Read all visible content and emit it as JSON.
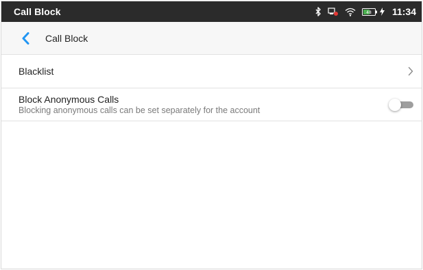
{
  "status_bar": {
    "title": "Call Block",
    "time": "11:34",
    "icons": [
      "bluetooth-icon",
      "network-disconnected-icon",
      "wifi-icon",
      "battery-icon",
      "charging-icon"
    ],
    "battery_label": "48"
  },
  "app_bar": {
    "back_icon": "chevron-left-icon",
    "title": "Call Block",
    "accent_color": "#2196f3"
  },
  "settings": {
    "blacklist": {
      "label": "Blacklist",
      "icon": "chevron-right-icon"
    },
    "block_anonymous": {
      "title": "Block Anonymous Calls",
      "subtitle": "Blocking anonymous calls can be set separately for the account",
      "enabled": false
    }
  }
}
